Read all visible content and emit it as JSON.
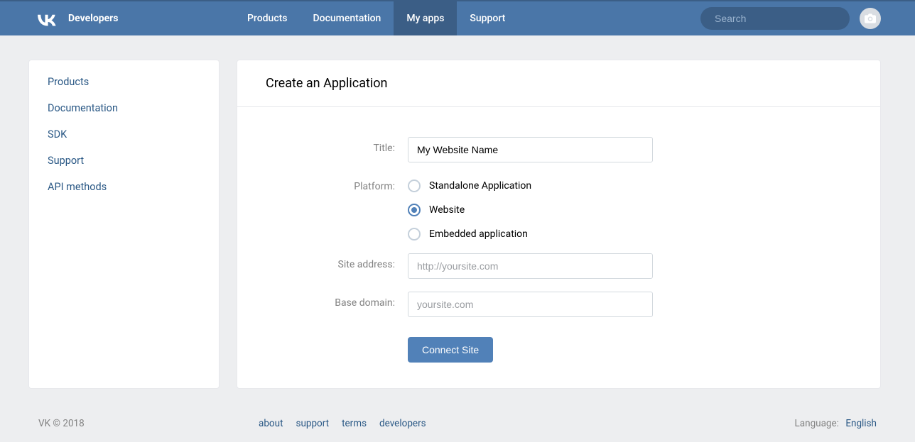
{
  "brand": "Developers",
  "topnav": {
    "items": [
      "Products",
      "Documentation",
      "My apps",
      "Support"
    ],
    "active_index": 2
  },
  "search": {
    "placeholder": "Search",
    "value": ""
  },
  "sidebar": {
    "items": [
      "Products",
      "Documentation",
      "SDK",
      "Support",
      "API methods"
    ]
  },
  "main": {
    "title": "Create an Application",
    "form": {
      "title_label": "Title:",
      "title_value": "My Website Name",
      "platform_label": "Platform:",
      "platform_options": [
        "Standalone Application",
        "Website",
        "Embedded application"
      ],
      "platform_selected_index": 1,
      "site_address_label": "Site address:",
      "site_address_placeholder": "http://yoursite.com",
      "site_address_value": "",
      "base_domain_label": "Base domain:",
      "base_domain_placeholder": "yoursite.com",
      "base_domain_value": "",
      "submit_label": "Connect Site"
    }
  },
  "footer": {
    "copyright": "VK © 2018",
    "links": [
      "about",
      "support",
      "terms",
      "developers"
    ],
    "language_label": "Language:",
    "language_value": "English"
  }
}
